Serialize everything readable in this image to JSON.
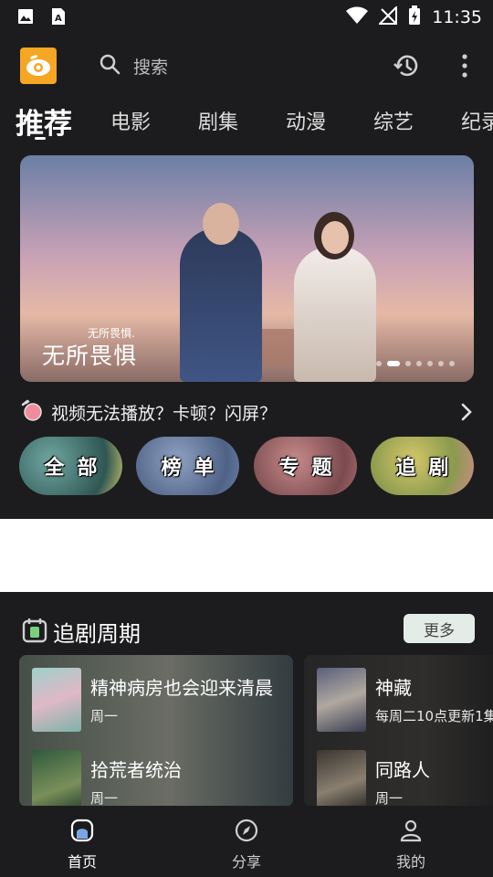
{
  "status_bar": {
    "time": "11:35"
  },
  "header": {
    "search_placeholder": "搜索"
  },
  "tabs": [
    {
      "label": "推荐",
      "active": true
    },
    {
      "label": "电影"
    },
    {
      "label": "剧集"
    },
    {
      "label": "动漫"
    },
    {
      "label": "综艺"
    },
    {
      "label": "纪录"
    }
  ],
  "banner": {
    "title": "无所畏惧",
    "title_small": "无所畏惧.",
    "slide_count": 7,
    "active_slide": 1
  },
  "notice": {
    "text": "视频无法播放？卡顿？闪屏？"
  },
  "categories": [
    {
      "label": "全部"
    },
    {
      "label": "榜单"
    },
    {
      "label": "专题"
    },
    {
      "label": "追剧"
    }
  ],
  "schedule": {
    "title": "追剧周期",
    "more_label": "更多",
    "cards": [
      {
        "items": [
          {
            "title": "精神病房也会迎来清晨",
            "subtitle": "周一"
          },
          {
            "title": "拾荒者统治",
            "subtitle": "周一"
          }
        ]
      },
      {
        "items": [
          {
            "title": "神藏",
            "subtitle": "每周二10点更新1集"
          },
          {
            "title": "同路人",
            "subtitle": "周一"
          }
        ]
      }
    ]
  },
  "tabbar": [
    {
      "label": "首页",
      "icon": "home-icon",
      "active": true
    },
    {
      "label": "分享",
      "icon": "compass-icon"
    },
    {
      "label": "我的",
      "icon": "profile-icon"
    }
  ]
}
